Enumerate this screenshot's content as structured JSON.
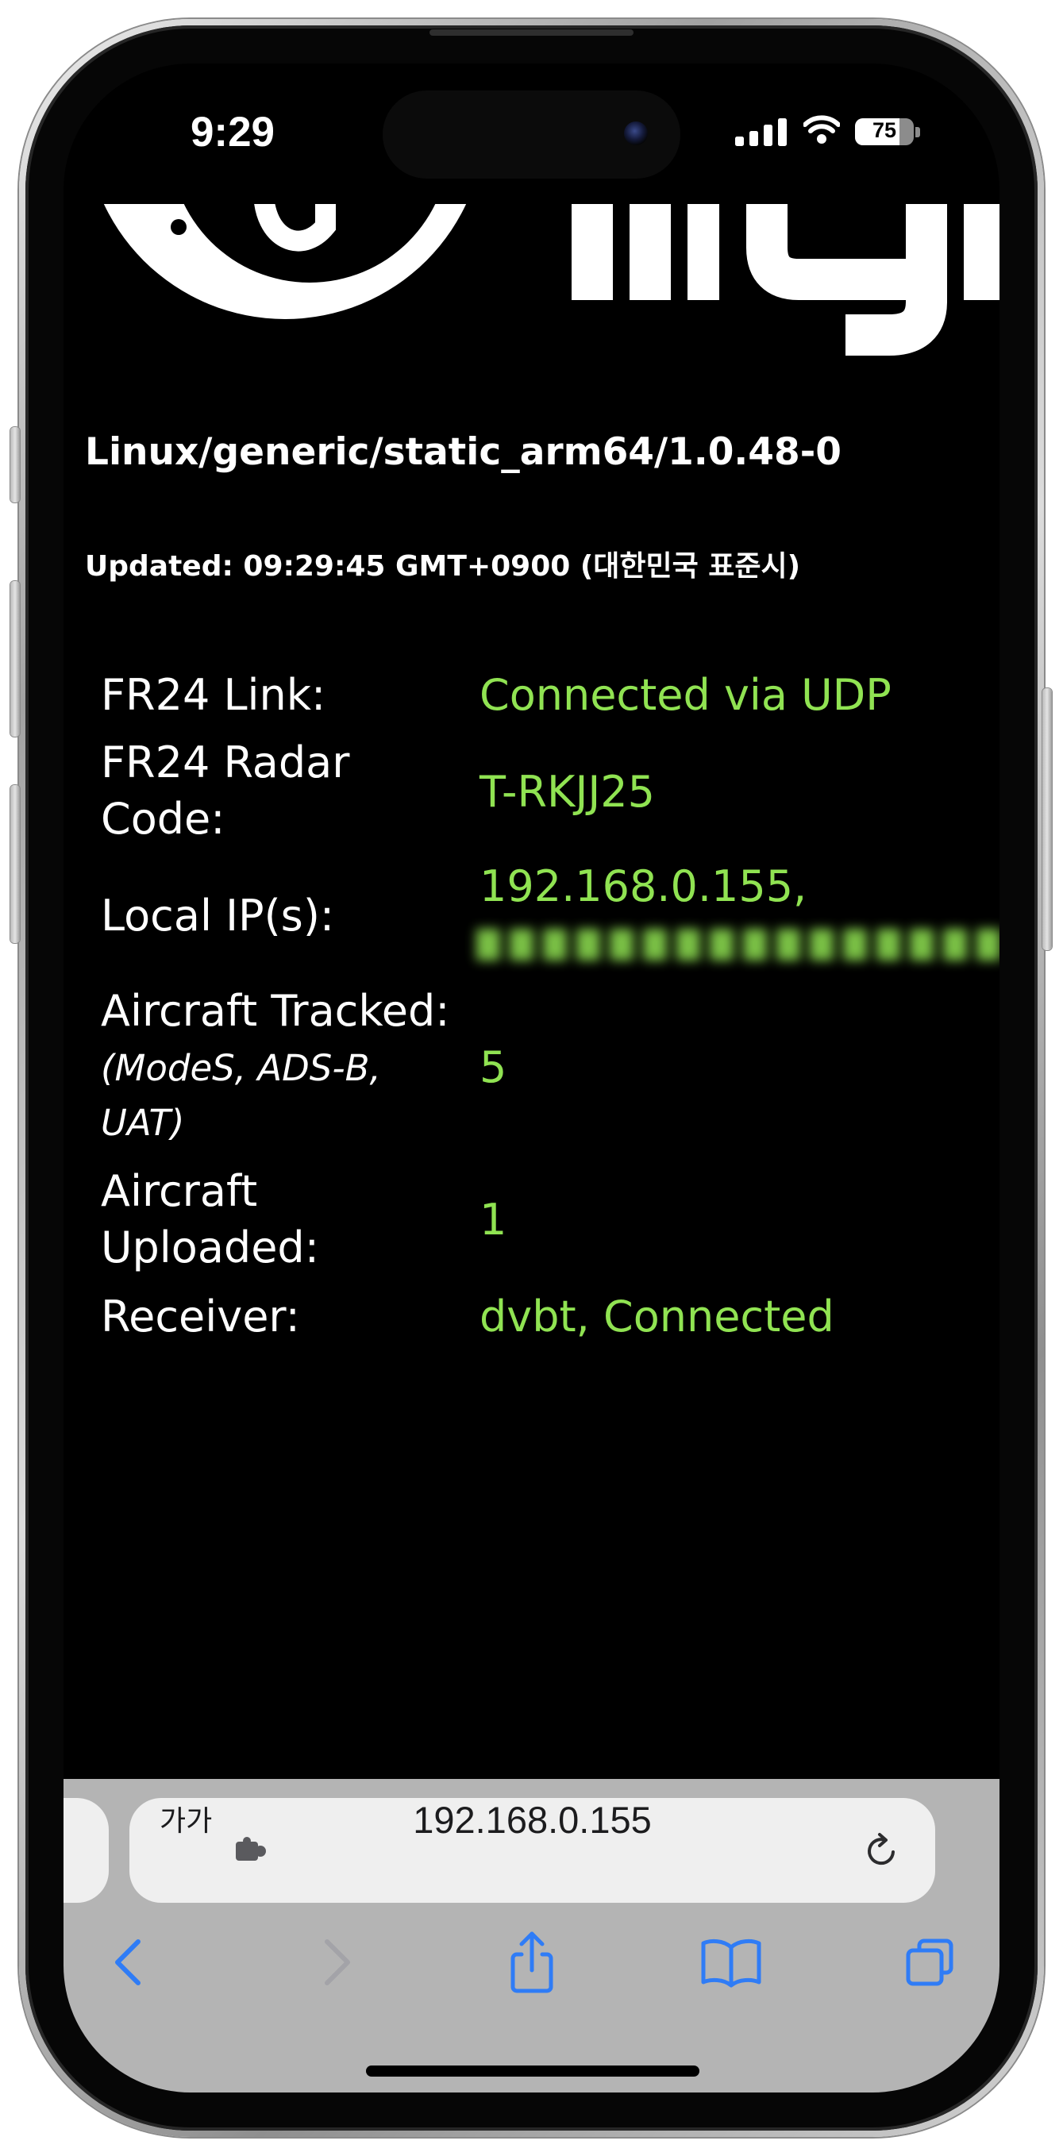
{
  "status_bar": {
    "time": "9:29",
    "battery_level": 75,
    "battery_text": "75",
    "icons": {
      "cellular": "cellular-signal-icon",
      "wifi": "wifi-icon",
      "battery": "battery-icon"
    }
  },
  "logo": {
    "icon": "site-logo-icon"
  },
  "page": {
    "version": "Linux/generic/static_arm64/1.0.48-0",
    "updated": "Updated: 09:29:45 GMT+0900 (대한민국 표준시)",
    "rows": [
      {
        "label_lines": [
          "FR24 Link:"
        ],
        "value_lines": [
          "Connected via UDP"
        ]
      },
      {
        "label_lines": [
          "FR24 Radar",
          "Code:"
        ],
        "value_lines": [
          "T-RKJJ25"
        ]
      },
      {
        "label_lines": [
          "Local IP(s):"
        ],
        "value_lines": [
          "192.168.0.155,"
        ]
      },
      {
        "label_lines": [
          "Aircraft Tracked:"
        ],
        "note_lines": [
          "(ModeS, ADS-B,",
          "UAT)"
        ],
        "value_lines": [
          "5"
        ]
      },
      {
        "label_lines": [
          "Aircraft",
          "Uploaded:"
        ],
        "value_lines": [
          "1"
        ]
      },
      {
        "label_lines": [
          "Receiver:"
        ],
        "value_lines": [
          "dvbt, Connected"
        ]
      }
    ]
  },
  "safari": {
    "address_bar": {
      "text_size_label": "가가",
      "url": "192.168.0.155"
    },
    "icons": {
      "extension": "puzzle-piece-icon",
      "reload": "reload-icon",
      "back": "chevron-left-icon",
      "forward": "chevron-right-icon",
      "share": "share-icon",
      "bookmarks": "book-icon",
      "tabs": "tabs-icon"
    }
  },
  "colors": {
    "page_background": "#000000",
    "label_text": "#ffffff",
    "value_text": "#90e352",
    "toolbar_background": "#b4b4b4",
    "address_bar": "#efefef",
    "accent": "#2f7cf6",
    "disabled": "#a3a3a8"
  }
}
